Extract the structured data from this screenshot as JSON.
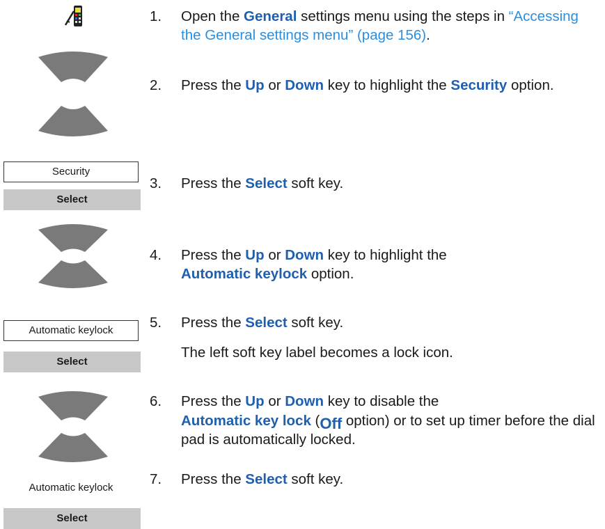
{
  "steps": [
    {
      "num": "1.",
      "parts": [
        "Open the ",
        "General",
        " settings menu using the steps in ",
        "“Accessing the General settings menu” (page 156)",
        "."
      ]
    },
    {
      "num": "2.",
      "parts": [
        "Press the ",
        "Up",
        " or ",
        "Down",
        " key to highlight the ",
        "Security",
        " option."
      ]
    },
    {
      "num": "3.",
      "parts": [
        "Press the ",
        "Select",
        " soft key."
      ]
    },
    {
      "num": "4.",
      "parts": [
        "Press the ",
        "Up",
        " or ",
        "Down",
        " key to highlight the ",
        "Automatic keylock",
        " option."
      ]
    },
    {
      "num": "5.",
      "parts": [
        "Press the ",
        "Select",
        " soft key."
      ],
      "note": "The left soft key label becomes a lock icon."
    },
    {
      "num": "6.",
      "parts": [
        "Press the ",
        "Up",
        " or ",
        "Down",
        " key to disable the ",
        "Automatic key lock",
        " (",
        "Off",
        " option) or to set up timer before the dial pad is automatically locked."
      ]
    },
    {
      "num": "7.",
      "parts": [
        "Press the ",
        "Select",
        " soft key."
      ]
    }
  ],
  "icons": {
    "menu_icon": "phone-menu-icon",
    "nav_icon": "up-down-navigation-key-icon"
  },
  "labels": {
    "security_screen": "Security",
    "select_key": "Select",
    "autokeylock_screen": "Automatic keylock",
    "autokeylock_plain": "Automatic keylock"
  },
  "colors": {
    "keyword": "#1f5fb0",
    "link": "#2b8fe0",
    "softkey_bg": "#c8c8c8",
    "nav_key": "#7a7a7a"
  }
}
